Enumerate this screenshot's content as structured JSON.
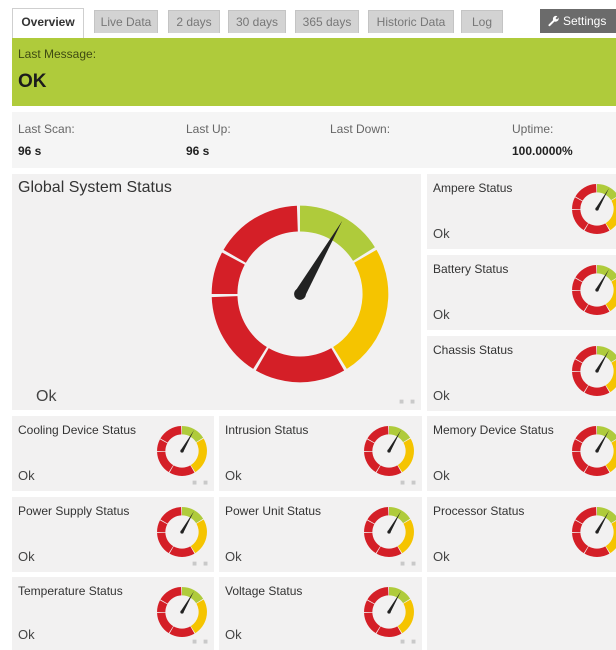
{
  "tabs": [
    {
      "label": "Overview",
      "active": true
    },
    {
      "label": "Live Data"
    },
    {
      "label": "2 days"
    },
    {
      "label": "30 days"
    },
    {
      "label": "365 days"
    },
    {
      "label": "Historic Data"
    },
    {
      "label": "Log"
    }
  ],
  "settings_label": "Settings",
  "message": {
    "label": "Last Message:",
    "value": "OK"
  },
  "scan_info": [
    {
      "label": "Last Scan:",
      "value": "96 s"
    },
    {
      "label": "Last Up:",
      "value": "96 s"
    },
    {
      "label": "Last Down:",
      "value": ""
    },
    {
      "label": "Uptime:",
      "value": "100.0000%"
    }
  ],
  "global": {
    "title": "Global System Status",
    "state": "Ok"
  },
  "sensors": [
    {
      "title": "Ampere Status",
      "state": "Ok"
    },
    {
      "title": "Battery Status",
      "state": "Ok"
    },
    {
      "title": "Chassis Status",
      "state": "Ok"
    },
    {
      "title": "Cooling Device Status",
      "state": "Ok"
    },
    {
      "title": "Intrusion Status",
      "state": "Ok"
    },
    {
      "title": "Memory Device Status",
      "state": "Ok"
    },
    {
      "title": "Power Supply Status",
      "state": "Ok"
    },
    {
      "title": "Power Unit Status",
      "state": "Ok"
    },
    {
      "title": "Processor Status",
      "state": "Ok"
    },
    {
      "title": "Temperature Status",
      "state": "Ok"
    },
    {
      "title": "Voltage Status",
      "state": "Ok"
    }
  ],
  "colors": {
    "ok_green": "#afcb3b",
    "warn_yellow": "#f5c400",
    "error_red": "#d41f27",
    "needle": "#222222"
  }
}
